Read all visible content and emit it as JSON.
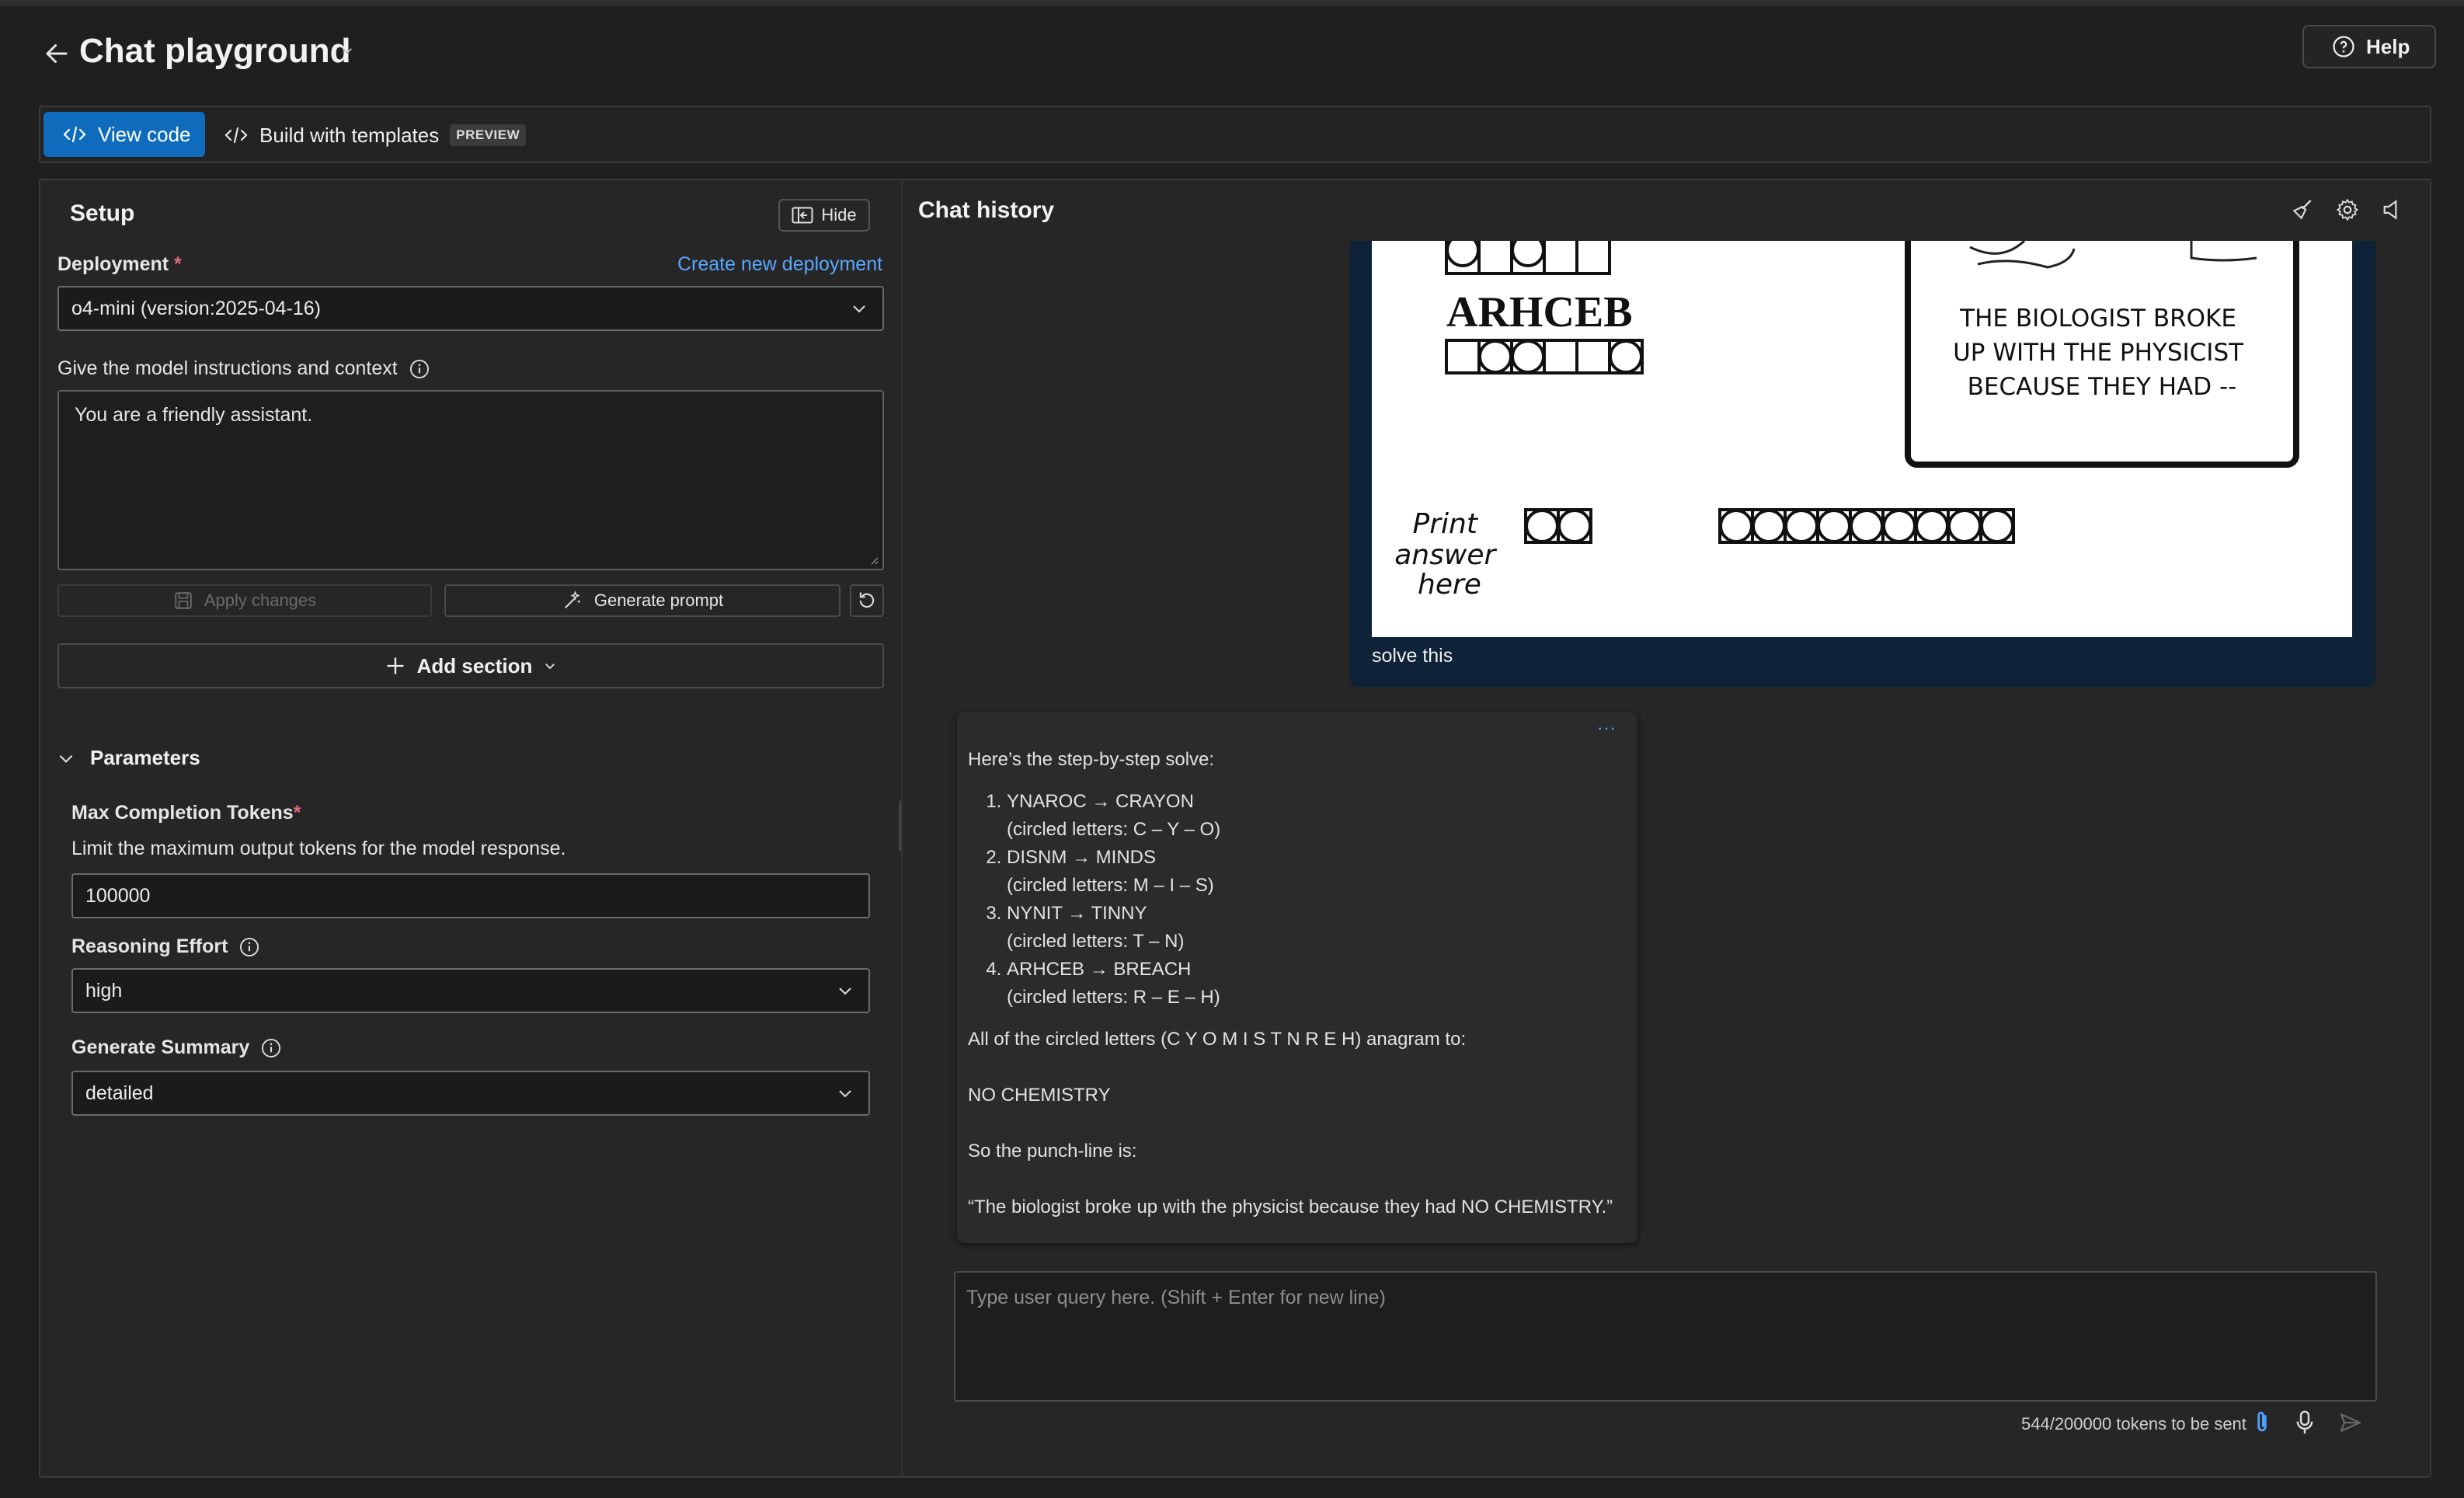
{
  "header": {
    "title": "Chat playground",
    "help_label": "Help"
  },
  "toolbar": {
    "view_code_label": "View code",
    "templates_label": "Build with templates",
    "preview_badge": "PREVIEW"
  },
  "setup": {
    "title": "Setup",
    "hide_label": "Hide",
    "deployment_label": "Deployment",
    "required_mark": "*",
    "create_deployment_link": "Create new deployment",
    "deployment_value": "o4-mini (version:2025-04-16)",
    "instructions_label": "Give the model instructions and context",
    "instructions_value": "You are a friendly assistant.",
    "apply_changes_label": "Apply changes",
    "generate_prompt_label": "Generate prompt",
    "add_section_label": "Add section"
  },
  "parameters": {
    "title": "Parameters",
    "max_tokens_label": "Max Completion Tokens",
    "max_tokens_help": "Limit the maximum output tokens for the model response.",
    "max_tokens_value": "100000",
    "reasoning_label": "Reasoning Effort",
    "reasoning_value": "high",
    "summary_label": "Generate Summary",
    "summary_value": "detailed"
  },
  "chat": {
    "title": "Chat history",
    "user_message": {
      "image": {
        "scrambled_word": "ARHCEB",
        "cartoon_caption": "THE BIOLOGIST BROKE UP WITH THE PHYSICIST BECAUSE THEY HAD --",
        "print_answer_label": "Print answer here",
        "answer_boxes_group1": 2,
        "answer_boxes_group2": 9
      },
      "text": "solve this"
    },
    "assistant_message": {
      "more_label": "···",
      "intro": "Here’s the step-by-step solve:",
      "steps": [
        {
          "word": "YNAROC → CRAYON",
          "detail": "(circled letters: C – Y – O)"
        },
        {
          "word": "DISNM → MINDS",
          "detail": "(circled letters: M – I – S)"
        },
        {
          "word": "NYNIT → TINNY",
          "detail": "(circled letters: T – N)"
        },
        {
          "word": "ARHCEB → BREACH",
          "detail": "(circled letters: R – E – H)"
        }
      ],
      "anagram_line": "All of the circled letters (C Y O M I S T N R E H) anagram to:",
      "answer": "NO CHEMISTRY",
      "punchline_intro": "So the punch-line is:",
      "punchline": "“The biologist broke up with the physicist because they had NO CHEMISTRY.”"
    },
    "input_placeholder": "Type user query here. (Shift + Enter for new line)",
    "token_count": "544/200000 tokens to be sent"
  }
}
